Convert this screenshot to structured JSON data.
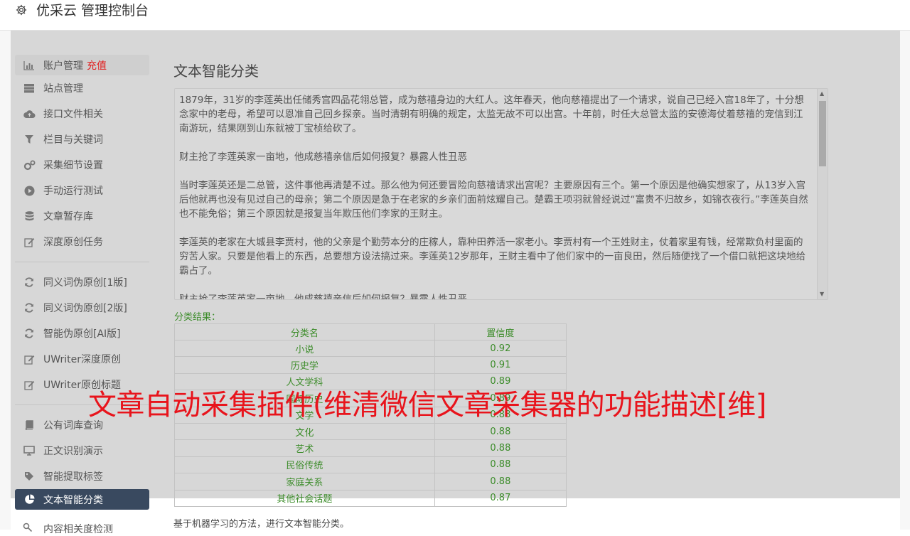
{
  "header": {
    "title": "优采云 管理控制台",
    "icon": "gear-icon"
  },
  "sidebar": {
    "group1": [
      {
        "label": "账户管理",
        "extra": "充值",
        "icon": "bar-chart-icon"
      },
      {
        "label": "站点管理",
        "icon": "server-icon"
      },
      {
        "label": "接口文件相关",
        "icon": "cloud-upload-icon"
      },
      {
        "label": "栏目与关键词",
        "icon": "filter-icon"
      },
      {
        "label": "采集细节设置",
        "icon": "cogs-icon"
      },
      {
        "label": "手动运行测试",
        "icon": "play-circle-icon"
      },
      {
        "label": "文章暂存库",
        "icon": "database-icon"
      },
      {
        "label": "深度原创任务",
        "icon": "edit-icon"
      }
    ],
    "group2": [
      {
        "label": "同义词伪原创[1版]",
        "icon": "refresh-icon"
      },
      {
        "label": "同义词伪原创[2版]",
        "icon": "refresh-icon"
      },
      {
        "label": "智能伪原创[AI版]",
        "icon": "refresh-icon"
      },
      {
        "label": "UWriter深度原创",
        "icon": "edit-icon"
      },
      {
        "label": "UWriter原创标题",
        "icon": "edit-icon"
      }
    ],
    "group3": [
      {
        "label": "公有词库查询",
        "icon": "book-icon"
      },
      {
        "label": "正文识别演示",
        "icon": "desktop-icon"
      },
      {
        "label": "智能提取标签",
        "icon": "tag-icon"
      },
      {
        "label": "文本智能分类",
        "icon": "pie-chart-icon"
      }
    ],
    "cut_item": "内容相关度检测"
  },
  "main": {
    "title": "文本智能分类",
    "article": [
      "1879年，31岁的李莲英出任储秀宫四品花翎总管，成为慈禧身边的大红人。这年春天，他向慈禧提出了一个请求，说自己已经入宫18年了，十分想念家中的老母，希望可以恩准自己回乡探亲。当时清朝有明确的规定，太监无故不可以出宫。十年前，时任大总管太监的安德海仗着慈禧的宠信到江南游玩，结果刚到山东就被丁宝桢给砍了。",
      "财主抢了李莲英家一亩地，他成慈禧亲信后如何报复？暴露人性丑恶",
      "当时李莲英还是二总管，这件事他再清楚不过。那么他为何还要冒险向慈禧请求出宫呢？主要原因有三个。第一个原因是他确实想家了，从13岁入宫后他就再也没有见过自己的母亲；第二个原因是急于在老家的乡亲们面前炫耀自己。楚霸王项羽就曾经说过“富贵不归故乡，如锦衣夜行。”李莲英自然也不能免俗；第三个原因就是报复当年欺压他们李家的王财主。",
      "李莲英的老家在大城县李贾村，他的父亲是个勤劳本分的庄稼人，靠种田养活一家老小。李贾村有一个王姓财主，仗着家里有钱，经常欺负村里面的穷苦人家。只要是他看上的东西，总要想方设法搞过来。李莲英12岁那年，王财主看中了他们家中的一亩良田，然后随便找了一个借口就把这块地给霸占了。",
      "财主抢了李莲英家一亩地，他成慈禧亲信后如何报复？暴露人性丑恶"
    ],
    "result_label": "分类结果：",
    "table": {
      "headers": [
        "分类名",
        "置信度"
      ],
      "rows": [
        [
          "小说",
          "0.92"
        ],
        [
          "历史学",
          "0.91"
        ],
        [
          "人文学科",
          "0.89"
        ],
        [
          "国际历史",
          "0.89"
        ],
        [
          "文学",
          "0.88"
        ],
        [
          "文化",
          "0.88"
        ],
        [
          "艺术",
          "0.88"
        ],
        [
          "民俗传统",
          "0.88"
        ],
        [
          "家庭关系",
          "0.88"
        ],
        [
          "其他社会话题",
          "0.87"
        ]
      ]
    },
    "footer": "基于机器学习的方法，进行文本智能分类。"
  },
  "watermark": "文章自动采集插件(维清微信文章采集器的功能描述[维]",
  "colors": {
    "accent_red": "#e21c1c",
    "result_green": "#3c8c2a",
    "active_nav": "#39495f"
  }
}
